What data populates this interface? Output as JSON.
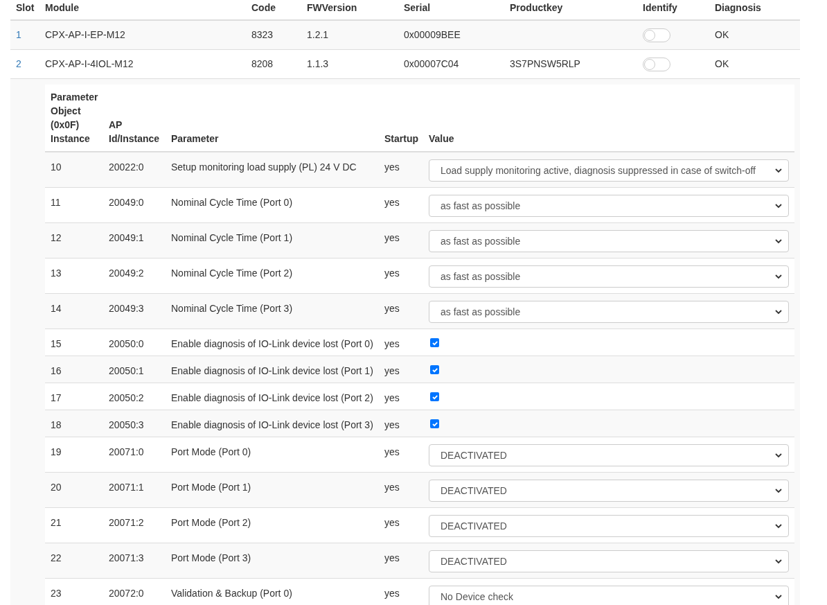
{
  "modules": {
    "columns": [
      "Slot",
      "Module",
      "Code",
      "FWVersion",
      "Serial",
      "Productkey",
      "Identify",
      "Diagnosis"
    ],
    "rows": [
      {
        "slot": "1",
        "module": "CPX-AP-I-EP-M12",
        "code": "8323",
        "fwversion": "1.2.1",
        "serial": "0x00009BEE",
        "productkey": "",
        "identify": false,
        "diagnosis": "OK"
      },
      {
        "slot": "2",
        "module": "CPX-AP-I-4IOL-M12",
        "code": "8208",
        "fwversion": "1.1.3",
        "serial": "0x00007C04",
        "productkey": "3S7PNSW5RLP",
        "identify": false,
        "diagnosis": "OK"
      }
    ]
  },
  "parameters": {
    "columns": [
      "Parameter Object (0x0F) Instance",
      "AP Id/Instance",
      "Parameter",
      "Startup",
      "Value"
    ],
    "rows": [
      {
        "instance": "10",
        "ap_id": "20022:0",
        "parameter": "Setup monitoring load supply (PL) 24 V DC",
        "startup": "yes",
        "kind": "select",
        "value": "Load supply monitoring active, diagnosis suppressed in case of switch-off"
      },
      {
        "instance": "11",
        "ap_id": "20049:0",
        "parameter": "Nominal Cycle Time (Port 0)",
        "startup": "yes",
        "kind": "select",
        "value": "as fast as possible"
      },
      {
        "instance": "12",
        "ap_id": "20049:1",
        "parameter": "Nominal Cycle Time (Port 1)",
        "startup": "yes",
        "kind": "select",
        "value": "as fast as possible"
      },
      {
        "instance": "13",
        "ap_id": "20049:2",
        "parameter": "Nominal Cycle Time (Port 2)",
        "startup": "yes",
        "kind": "select",
        "value": "as fast as possible"
      },
      {
        "instance": "14",
        "ap_id": "20049:3",
        "parameter": "Nominal Cycle Time (Port 3)",
        "startup": "yes",
        "kind": "select",
        "value": "as fast as possible"
      },
      {
        "instance": "15",
        "ap_id": "20050:0",
        "parameter": "Enable diagnosis of IO-Link device lost (Port 0)",
        "startup": "yes",
        "kind": "checkbox",
        "checked": true
      },
      {
        "instance": "16",
        "ap_id": "20050:1",
        "parameter": "Enable diagnosis of IO-Link device lost (Port 1)",
        "startup": "yes",
        "kind": "checkbox",
        "checked": true
      },
      {
        "instance": "17",
        "ap_id": "20050:2",
        "parameter": "Enable diagnosis of IO-Link device lost (Port 2)",
        "startup": "yes",
        "kind": "checkbox",
        "checked": true
      },
      {
        "instance": "18",
        "ap_id": "20050:3",
        "parameter": "Enable diagnosis of IO-Link device lost (Port 3)",
        "startup": "yes",
        "kind": "checkbox",
        "checked": true
      },
      {
        "instance": "19",
        "ap_id": "20071:0",
        "parameter": "Port Mode (Port 0)",
        "startup": "yes",
        "kind": "select",
        "value": "DEACTIVATED"
      },
      {
        "instance": "20",
        "ap_id": "20071:1",
        "parameter": "Port Mode (Port 1)",
        "startup": "yes",
        "kind": "select",
        "value": "DEACTIVATED"
      },
      {
        "instance": "21",
        "ap_id": "20071:2",
        "parameter": "Port Mode (Port 2)",
        "startup": "yes",
        "kind": "select",
        "value": "DEACTIVATED"
      },
      {
        "instance": "22",
        "ap_id": "20071:3",
        "parameter": "Port Mode (Port 3)",
        "startup": "yes",
        "kind": "select",
        "value": "DEACTIVATED"
      },
      {
        "instance": "23",
        "ap_id": "20072:0",
        "parameter": "Validation & Backup (Port 0)",
        "startup": "yes",
        "kind": "select",
        "value": "No Device check"
      }
    ]
  }
}
